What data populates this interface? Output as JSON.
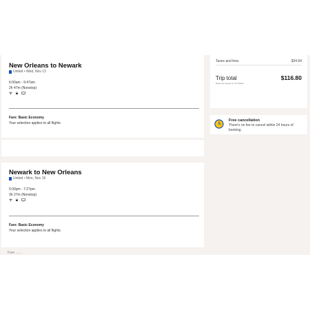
{
  "outbound": {
    "title": "New Orleans to Newark",
    "airline_date": "United • Wed, Nov 13",
    "times": "6:00am - 9:47am",
    "duration": "2h 47m (Nonstop)",
    "fare_label": "Fare: Basic Economy",
    "fare_note": "Your selection applies to all flights"
  },
  "return": {
    "title": "Newark to New Orleans",
    "airline_date": "United • Mon, Nov 15",
    "times": "5:00pm - 7:27pm",
    "duration": "3h 27m (Nonstop)",
    "fare_label": "Fare: Basic Economy",
    "fare_note": "Your selection applies to all flights",
    "partial_text": "Fare ......"
  },
  "price_summary": {
    "taxes_label": "Taxes and fees",
    "taxes_value": "$34.94",
    "trip_total_label": "Trip total",
    "trip_total_value": "$116.80",
    "rates_note": "Rates are quoted in US dollars"
  },
  "free_cancellation": {
    "title": "Free cancellation",
    "text": "There's no fee to cancel within 24 hours of booking."
  },
  "colors": {
    "page_background": "#f5f2f0",
    "airline_brand": "#1a4fb8",
    "clock_ring": "#1a4fb8",
    "clock_fill": "#f5c518"
  },
  "icons": [
    "airline-logo-icon",
    "wifi-icon",
    "power-icon",
    "screen-icon",
    "clock-icon"
  ]
}
